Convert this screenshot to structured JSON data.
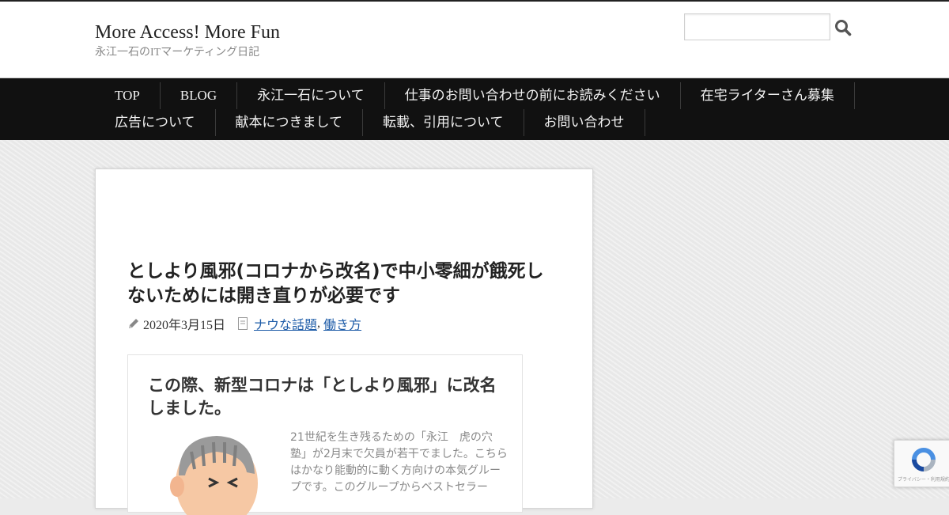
{
  "site": {
    "title": "More Access! More Fun",
    "description": "永江一石のITマーケティング日記"
  },
  "search": {
    "placeholder": "",
    "value": "",
    "icon": "search-icon"
  },
  "nav": {
    "row1": [
      "TOP",
      "BLOG",
      "永江一石について",
      "仕事のお問い合わせの前にお読みください",
      "在宅ライターさん募集"
    ],
    "row2": [
      "広告について",
      "献本につきまして",
      "転載、引用について",
      "お問い合わせ"
    ]
  },
  "post": {
    "title": "としより風邪(コロナから改名)で中小零細が餓死しないためには開き直りが必要です",
    "date": "2020年3月15日",
    "categories": [
      "ナウな話題",
      "働き方"
    ],
    "category_separator": ","
  },
  "box": {
    "title": "この際、新型コロナは「としより風邪」に改名しました。",
    "text": "21世紀を生き残るための「永江　虎の穴塾」が2月末で欠員が若干でました。こちらはかなり能動的に動く方向けの本気グループです。このグループからベストセラー"
  },
  "recaptcha": {
    "text": "プライバシー・利用規約"
  },
  "colors": {
    "nav_bg": "#111111",
    "link": "#1e5ca8",
    "page_bg": "#ececec"
  }
}
